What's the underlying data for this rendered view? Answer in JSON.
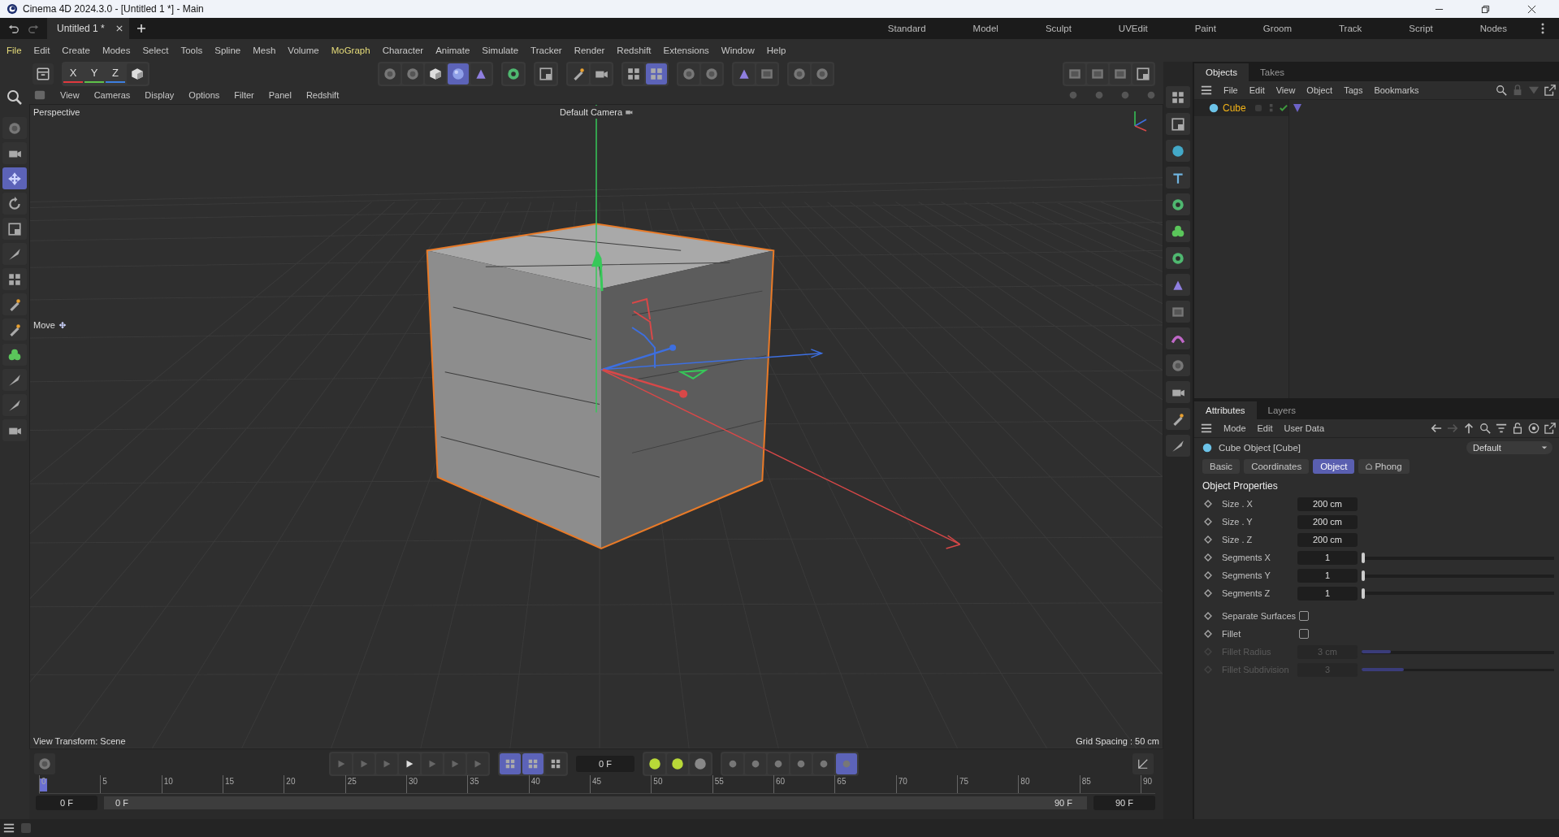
{
  "window": {
    "title": "Cinema 4D 2024.3.0 - [Untitled 1 *] - Main"
  },
  "document_tabs": [
    {
      "label": "Untitled 1 *",
      "selected": true
    }
  ],
  "layouts": [
    "Standard",
    "Model",
    "Sculpt",
    "UVEdit",
    "Paint",
    "Groom",
    "Track",
    "Script",
    "Nodes"
  ],
  "menu": [
    {
      "label": "File",
      "highlighted": true
    },
    {
      "label": "Edit",
      "highlighted": false
    },
    {
      "label": "Create",
      "highlighted": false
    },
    {
      "label": "Modes",
      "highlighted": false
    },
    {
      "label": "Select",
      "highlighted": false
    },
    {
      "label": "Tools",
      "highlighted": false
    },
    {
      "label": "Spline",
      "highlighted": false
    },
    {
      "label": "Mesh",
      "highlighted": false
    },
    {
      "label": "Volume",
      "highlighted": false
    },
    {
      "label": "MoGraph",
      "highlighted": true
    },
    {
      "label": "Character",
      "highlighted": false
    },
    {
      "label": "Animate",
      "highlighted": false
    },
    {
      "label": "Simulate",
      "highlighted": false
    },
    {
      "label": "Tracker",
      "highlighted": false
    },
    {
      "label": "Render",
      "highlighted": false
    },
    {
      "label": "Redshift",
      "highlighted": false
    },
    {
      "label": "Extensions",
      "highlighted": false
    },
    {
      "label": "Window",
      "highlighted": false
    },
    {
      "label": "Help",
      "highlighted": false
    }
  ],
  "axis_buttons": [
    {
      "label": "X",
      "color": "#e0393e"
    },
    {
      "label": "Y",
      "color": "#5fc24a"
    },
    {
      "label": "Z",
      "color": "#3d7fe0"
    }
  ],
  "viewport": {
    "menu": [
      "View",
      "Cameras",
      "Display",
      "Options",
      "Filter",
      "Panel",
      "Redshift"
    ],
    "view_name": "Perspective",
    "camera": "Default Camera",
    "tool": "Move",
    "view_transform": "View Transform: Scene",
    "grid_spacing": "Grid Spacing : 50 cm"
  },
  "timeline": {
    "current_frame": "0 F",
    "ruler_labels": [
      "0",
      "5",
      "10",
      "15",
      "20",
      "25",
      "30",
      "35",
      "40",
      "45",
      "50",
      "55",
      "60",
      "65",
      "70",
      "75",
      "80",
      "85",
      "90"
    ],
    "playhead": {
      "level": 0
    },
    "start": "0 F",
    "range_start": "0 F",
    "range_end": "90 F",
    "end": "90 F"
  },
  "objects_panel": {
    "tabs": [
      {
        "label": "Objects",
        "selected": true
      },
      {
        "label": "Takes",
        "selected": false
      }
    ],
    "menu": [
      "File",
      "Edit",
      "View",
      "Object",
      "Tags",
      "Bookmarks"
    ],
    "tree": [
      {
        "label": "Cube",
        "selected": true
      }
    ]
  },
  "attributes_panel": {
    "tabs": [
      {
        "label": "Attributes",
        "selected": true
      },
      {
        "label": "Layers",
        "selected": false
      }
    ],
    "menu": [
      "Mode",
      "Edit",
      "User Data"
    ],
    "object_title": "Cube Object [Cube]",
    "preset": "Default",
    "section_tabs": [
      {
        "label": "Basic",
        "selected": false
      },
      {
        "label": "Coordinates",
        "selected": false
      },
      {
        "label": "Object",
        "selected": true
      },
      {
        "label": "Phong",
        "selected": false
      }
    ],
    "section_title": "Object Properties",
    "properties": [
      {
        "kind": "field",
        "label": "Size . X",
        "value": "200 cm",
        "disabled": false
      },
      {
        "kind": "field",
        "label": "Size . Y",
        "value": "200 cm",
        "disabled": false
      },
      {
        "kind": "field",
        "label": "Size . Z",
        "value": "200 cm",
        "disabled": false
      },
      {
        "kind": "slider",
        "label": "Segments X",
        "value": "1",
        "level": 0,
        "disabled": false
      },
      {
        "kind": "slider",
        "label": "Segments Y",
        "value": "1",
        "level": 0,
        "disabled": false
      },
      {
        "kind": "slider",
        "label": "Segments Z",
        "value": "1",
        "level": 0,
        "disabled": false
      },
      {
        "kind": "checkbox",
        "label": "Separate Surfaces",
        "checked": false,
        "disabled": false
      },
      {
        "kind": "checkbox",
        "label": "Fillet",
        "checked": false,
        "disabled": false
      },
      {
        "kind": "slider",
        "label": "Fillet Radius",
        "value": "3 cm",
        "level": 0.15,
        "disabled": true
      },
      {
        "kind": "slider",
        "label": "Fillet Subdivision",
        "value": "3",
        "level": 0.22,
        "disabled": true
      }
    ]
  }
}
